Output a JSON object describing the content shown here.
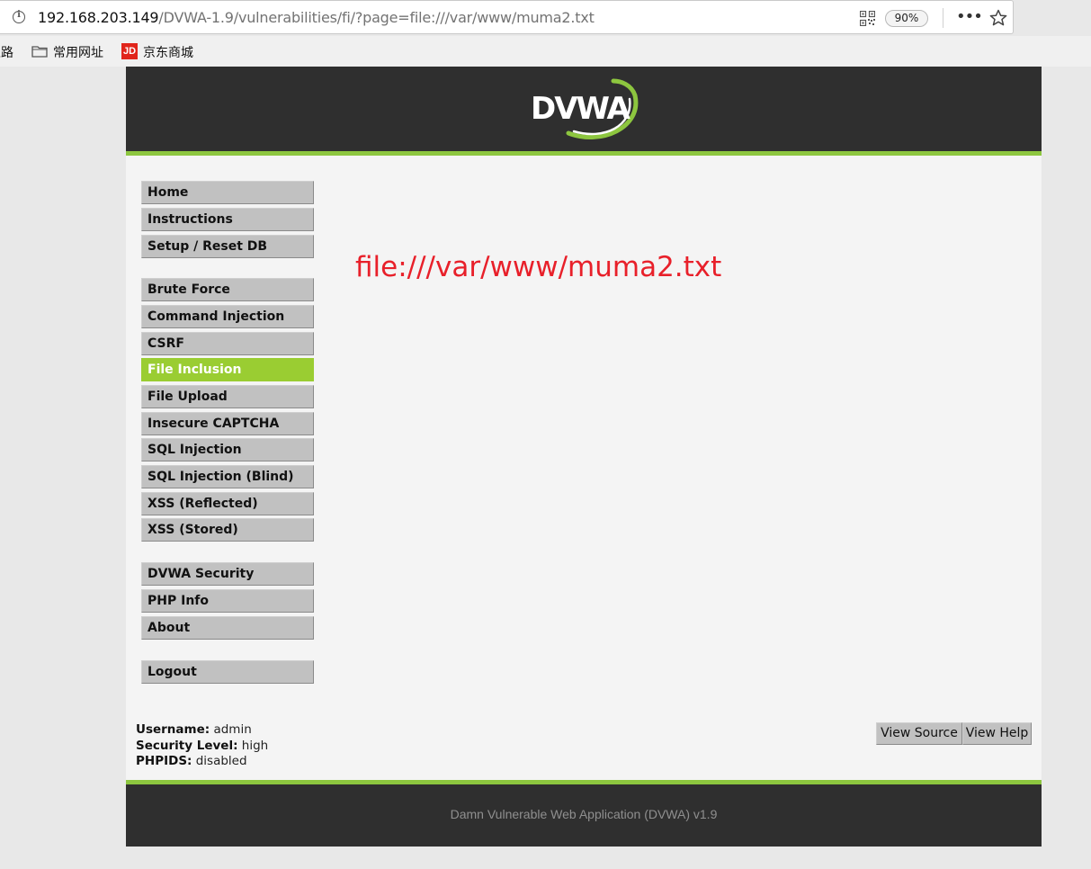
{
  "browser": {
    "url_host": "192.168.203.149",
    "url_path": "/DVWA-1.9/vulnerabilities/fi/?page=file:///var/www/muma2.txt",
    "zoom": "90%",
    "more_label": "•••",
    "bookmarks": [
      {
        "label": "上路"
      },
      {
        "label": "常用网址"
      },
      {
        "label": "京东商城"
      }
    ],
    "jd_badge": "JD"
  },
  "header": {
    "logo_text": "DVWA",
    "logo_color": "#8dc63f"
  },
  "menu": {
    "group1": [
      "Home",
      "Instructions",
      "Setup / Reset DB"
    ],
    "group2": [
      "Brute Force",
      "Command Injection",
      "CSRF",
      "File Inclusion",
      "File Upload",
      "Insecure CAPTCHA",
      "SQL Injection",
      "SQL Injection (Blind)",
      "XSS (Reflected)",
      "XSS (Stored)"
    ],
    "group3": [
      "DVWA Security",
      "PHP Info",
      "About"
    ],
    "group4": [
      "Logout"
    ],
    "active": "File Inclusion"
  },
  "content": {
    "text": "file:///var/www/muma2.txt",
    "color": "#e8202a"
  },
  "status": {
    "username_label": "Username:",
    "username_value": "admin",
    "security_label": "Security Level:",
    "security_value": "high",
    "phpids_label": "PHPIDS:",
    "phpids_value": "disabled"
  },
  "buttons": {
    "view_source": "View Source",
    "view_help": "View Help"
  },
  "footer": {
    "text": "Damn Vulnerable Web Application (DVWA) v1.9"
  }
}
